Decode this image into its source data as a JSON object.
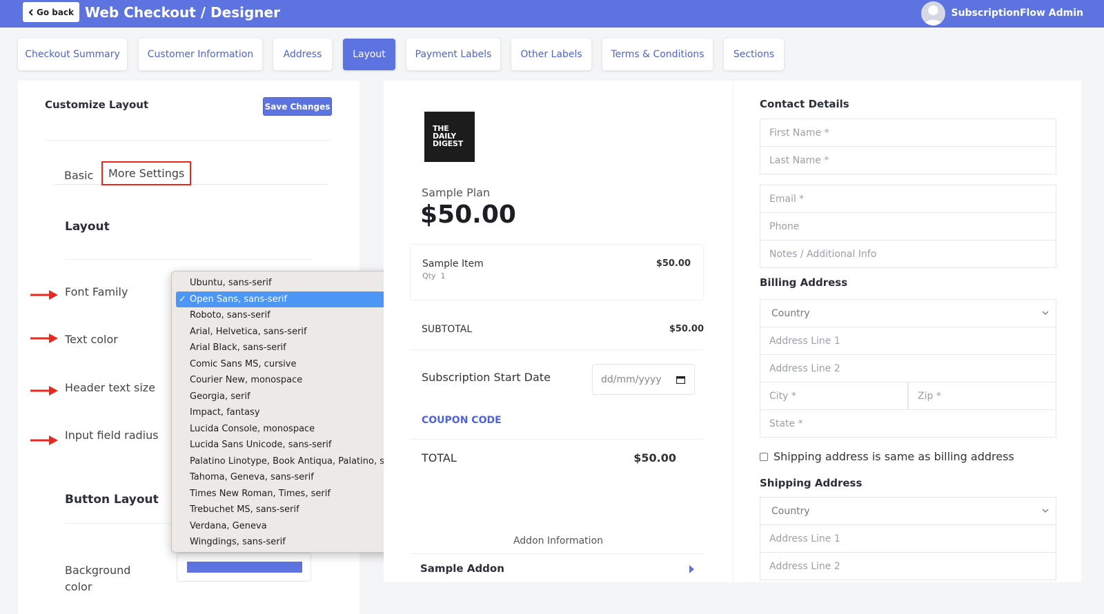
{
  "topbar": {
    "back_label": "Go back",
    "title": "Web Checkout / Designer",
    "user_name": "SubscriptionFlow Admin"
  },
  "tabs": [
    {
      "label": "Checkout Summary"
    },
    {
      "label": "Customer Information"
    },
    {
      "label": "Address"
    },
    {
      "label": "Layout"
    },
    {
      "label": "Payment Labels"
    },
    {
      "label": "Other Labels"
    },
    {
      "label": "Terms & Conditions"
    },
    {
      "label": "Sections"
    }
  ],
  "active_tab": "Layout",
  "left_panel": {
    "title": "Customize Layout",
    "save_label": "Save Changes",
    "sub_tabs": {
      "basic": "Basic",
      "more": "More Settings"
    },
    "layout_heading": "Layout",
    "fields": {
      "font_family": "Font Family",
      "text_color": "Text color",
      "header_text_size": "Header text size",
      "input_field_radius": "Input field radius"
    },
    "button_layout_heading": "Button Layout",
    "background_color_label": "Background color",
    "background_color_value": "#5d74e0"
  },
  "font_dropdown": {
    "selected": "Open Sans, sans-serif",
    "options": [
      "Ubuntu, sans-serif",
      "Open Sans, sans-serif",
      "Roboto, sans-serif",
      "Arial, Helvetica, sans-serif",
      "Arial Black, sans-serif",
      "Comic Sans MS, cursive",
      "Courier New, monospace",
      "Georgia, serif",
      "Impact, fantasy",
      "Lucida Console, monospace",
      "Lucida Sans Unicode, sans-serif",
      "Palatino Linotype, Book Antiqua, Palatino, serif",
      "Tahoma, Geneva, sans-serif",
      "Times New Roman, Times, serif",
      "Trebuchet MS, sans-serif",
      "Verdana, Geneva",
      "Wingdings, sans-serif"
    ]
  },
  "preview": {
    "logo_lines": [
      "THE",
      "DAILY",
      "DIGEST"
    ],
    "plan_name": "Sample Plan",
    "plan_price": "$50.00",
    "item": {
      "name": "Sample Item",
      "qty_label": "Qty",
      "qty": "1",
      "price": "$50.00"
    },
    "subtotal_label": "SUBTOTAL",
    "subtotal_value": "$50.00",
    "start_date_label": "Subscription Start Date",
    "date_placeholder": "dd/mm/yyyy",
    "coupon_label": "COUPON CODE",
    "total_label": "TOTAL",
    "total_value": "$50.00",
    "addon_info_label": "Addon Information",
    "addon_name": "Sample Addon"
  },
  "form": {
    "contact_heading": "Contact Details",
    "first_name": "First Name *",
    "last_name": "Last Name *",
    "email": "Email *",
    "phone": "Phone",
    "notes": "Notes / Additional Info",
    "billing_heading": "Billing Address",
    "billing_country": "Country",
    "billing_line1": "Address Line 1",
    "billing_line2": "Address Line 2",
    "city": "City *",
    "zip": "Zip *",
    "state": "State *",
    "same_address_label": "Shipping address is same as billing address",
    "shipping_heading": "Shipping Address",
    "shipping_country": "Country",
    "shipping_line1": "Address Line 1",
    "shipping_line2": "Address Line 2"
  }
}
